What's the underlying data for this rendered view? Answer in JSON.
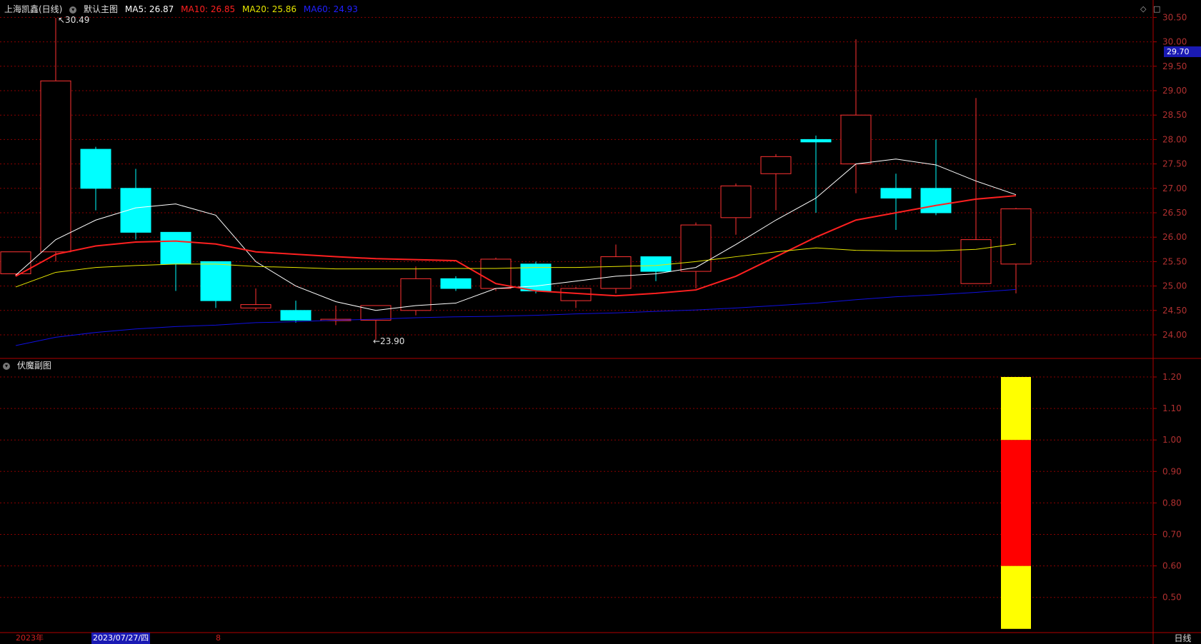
{
  "header": {
    "stock_name": "上海凯鑫(日线)",
    "indicator_name": "默认主图",
    "ma5": "MA5: 26.87",
    "ma10": "MA10: 26.85",
    "ma20": "MA20: 25.86",
    "ma60": "MA60: 24.93"
  },
  "subchart": {
    "title": "伏魔副图"
  },
  "annotations": {
    "high_label": "30.49",
    "low_label": "23.90"
  },
  "price_tag": "29.70",
  "footer": {
    "year": "2023年",
    "cursor_date": "2023/07/27/四",
    "mark": "8",
    "period": "日线"
  },
  "colors": {
    "up": "#ff3232",
    "down": "#00ffff",
    "ma5": "#ffffff",
    "ma10": "#ff2020",
    "ma20": "#e6e600",
    "ma60": "#1010e0",
    "grid": "#8b0000",
    "axis_text": "#d0d0d0"
  },
  "icons": [
    "collapse-circle-icon",
    "diamond-icon",
    "square-icon"
  ],
  "chart_data": [
    {
      "type": "candlestick",
      "title": "上海凯鑫(日线)",
      "yticks": [
        "24.00",
        "24.50",
        "25.00",
        "25.50",
        "26.00",
        "26.50",
        "27.00",
        "27.50",
        "28.00",
        "28.50",
        "29.00",
        "29.50",
        "30.00",
        "30.50"
      ],
      "ylim": [
        23.5,
        30.7
      ],
      "grid": true,
      "candles": [
        {
          "o": 25.25,
          "h": 25.7,
          "l": 25.2,
          "c": 25.7
        },
        {
          "o": 25.7,
          "h": 30.49,
          "l": 25.5,
          "c": 29.2
        },
        {
          "o": 27.8,
          "h": 27.85,
          "l": 26.55,
          "c": 27.0
        },
        {
          "o": 27.0,
          "h": 27.4,
          "l": 25.95,
          "c": 26.1
        },
        {
          "o": 26.1,
          "h": 26.1,
          "l": 24.9,
          "c": 25.45
        },
        {
          "o": 25.5,
          "h": 25.5,
          "l": 24.55,
          "c": 24.7
        },
        {
          "o": 24.55,
          "h": 24.95,
          "l": 24.5,
          "c": 24.62
        },
        {
          "o": 24.5,
          "h": 24.7,
          "l": 24.25,
          "c": 24.3
        },
        {
          "o": 24.3,
          "h": 24.6,
          "l": 24.2,
          "c": 24.32
        },
        {
          "o": 24.3,
          "h": 24.6,
          "l": 23.9,
          "c": 24.6
        },
        {
          "o": 24.5,
          "h": 25.4,
          "l": 24.4,
          "c": 25.15
        },
        {
          "o": 25.15,
          "h": 25.2,
          "l": 24.9,
          "c": 24.95
        },
        {
          "o": 24.95,
          "h": 25.58,
          "l": 24.9,
          "c": 25.55
        },
        {
          "o": 25.45,
          "h": 25.5,
          "l": 24.85,
          "c": 24.9
        },
        {
          "o": 24.7,
          "h": 24.98,
          "l": 24.55,
          "c": 24.95
        },
        {
          "o": 24.95,
          "h": 25.85,
          "l": 24.85,
          "c": 25.6
        },
        {
          "o": 25.6,
          "h": 25.6,
          "l": 25.1,
          "c": 25.3
        },
        {
          "o": 25.3,
          "h": 26.3,
          "l": 24.95,
          "c": 26.25
        },
        {
          "o": 26.4,
          "h": 27.1,
          "l": 26.05,
          "c": 27.05
        },
        {
          "o": 27.3,
          "h": 27.7,
          "l": 26.55,
          "c": 27.65
        },
        {
          "o": 28.0,
          "h": 28.08,
          "l": 26.5,
          "c": 27.95
        },
        {
          "o": 27.5,
          "h": 30.05,
          "l": 26.9,
          "c": 28.5
        },
        {
          "o": 27.0,
          "h": 27.3,
          "l": 26.15,
          "c": 26.8
        },
        {
          "o": 27.0,
          "h": 28.0,
          "l": 26.45,
          "c": 26.5
        },
        {
          "o": 25.05,
          "h": 28.85,
          "l": 25.05,
          "c": 25.95
        },
        {
          "o": 25.45,
          "h": 26.6,
          "l": 24.85,
          "c": 26.58
        }
      ],
      "series": [
        {
          "name": "MA5",
          "values": [
            25.22,
            25.95,
            26.35,
            26.6,
            26.68,
            26.45,
            25.5,
            25.0,
            24.68,
            24.5,
            24.6,
            24.65,
            24.95,
            25.0,
            25.1,
            25.2,
            25.25,
            25.38,
            25.85,
            26.35,
            26.8,
            27.5,
            27.6,
            27.48,
            27.15,
            26.87
          ]
        },
        {
          "name": "MA10",
          "values": [
            25.2,
            25.65,
            25.82,
            25.9,
            25.92,
            25.86,
            25.7,
            25.65,
            25.6,
            25.56,
            25.52,
            25.05,
            24.9,
            24.85,
            24.8,
            24.85,
            24.92,
            25.2,
            25.6,
            26.0,
            26.35,
            26.5,
            26.65,
            26.78,
            26.85
          ]
        },
        {
          "name": "MA20",
          "values": [
            24.98,
            25.28,
            25.38,
            25.42,
            25.45,
            25.45,
            25.4,
            25.38,
            25.35,
            25.35,
            25.35,
            25.36,
            25.36,
            25.38,
            25.38,
            25.4,
            25.42,
            25.5,
            25.6,
            25.7,
            25.78,
            25.73,
            25.72,
            25.72,
            25.75,
            25.86
          ]
        },
        {
          "name": "MA60",
          "values": [
            23.78,
            23.95,
            24.05,
            24.12,
            24.17,
            24.2,
            24.25,
            24.27,
            24.3,
            24.32,
            24.35,
            24.37,
            24.38,
            24.4,
            24.43,
            24.45,
            24.48,
            24.51,
            24.55,
            24.6,
            24.65,
            24.72,
            24.78,
            24.82,
            24.87,
            24.93
          ]
        }
      ]
    },
    {
      "type": "bar",
      "title": "伏魔副图",
      "yticks": [
        "0.50",
        "0.60",
        "0.70",
        "0.80",
        "0.90",
        "1.00",
        "1.10",
        "1.20"
      ],
      "ylim": [
        0.4,
        1.25
      ],
      "grid": true,
      "bar_index": 25,
      "segments": [
        {
          "from": 0.4,
          "to": 0.6,
          "color": "#ffff00"
        },
        {
          "from": 0.6,
          "to": 1.0,
          "color": "#ff0000"
        },
        {
          "from": 1.0,
          "to": 1.2,
          "color": "#ffff00"
        }
      ]
    }
  ]
}
